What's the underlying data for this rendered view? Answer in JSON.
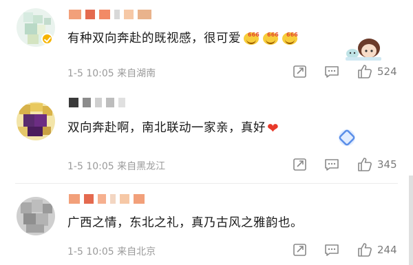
{
  "comments": [
    {
      "text": "有种双向奔赴的既视感，很可爱",
      "emoji_tags": [
        "666",
        "666",
        "666"
      ],
      "time": "1-5 10:05",
      "location": "来自湖南",
      "likes": "524",
      "verified": true
    },
    {
      "text": "双向奔赴啊，南北联动一家亲，真好",
      "time": "1-5 10:05",
      "location": "来自黑龙江",
      "likes": "345"
    },
    {
      "text": "广西之情，东北之礼，真乃古风之雅韵也。",
      "time": "1-5 10:05",
      "location": "来自北京",
      "likes": "244"
    }
  ],
  "icons": {
    "share": "share-icon",
    "reply": "comment-icon",
    "like": "thumbs-up-icon",
    "verified": "verified-badge-icon",
    "heart": "heart-emoji-icon"
  },
  "colors": {
    "meta_text": "#9a9a9a",
    "verified_badge": "#f6b400",
    "heart": "#e8392a"
  }
}
